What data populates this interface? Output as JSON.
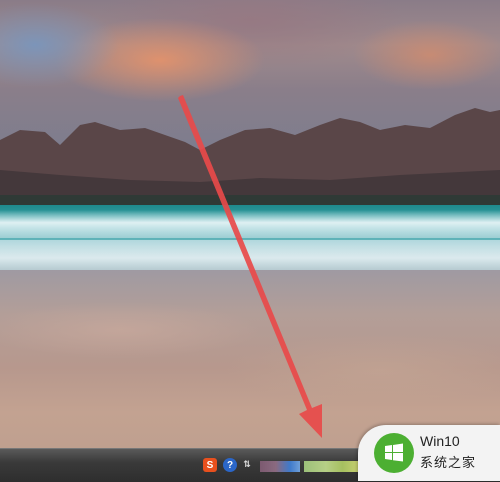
{
  "wallpaper": {
    "subject": "beach-sunset"
  },
  "annotation": {
    "type": "red-arrow",
    "color": "#e84a4a"
  },
  "taskbar": {
    "tray_icons": [
      {
        "name": "sogou-input-icon",
        "glyph": "S",
        "color": "#e8501e"
      },
      {
        "name": "help-icon",
        "glyph": "?",
        "color": "#2b66c8"
      },
      {
        "name": "network-icon",
        "glyph": "⇅"
      }
    ]
  },
  "watermark": {
    "title": "Win10",
    "subtitle": "系统之家",
    "logo_color": "#4caf32"
  }
}
